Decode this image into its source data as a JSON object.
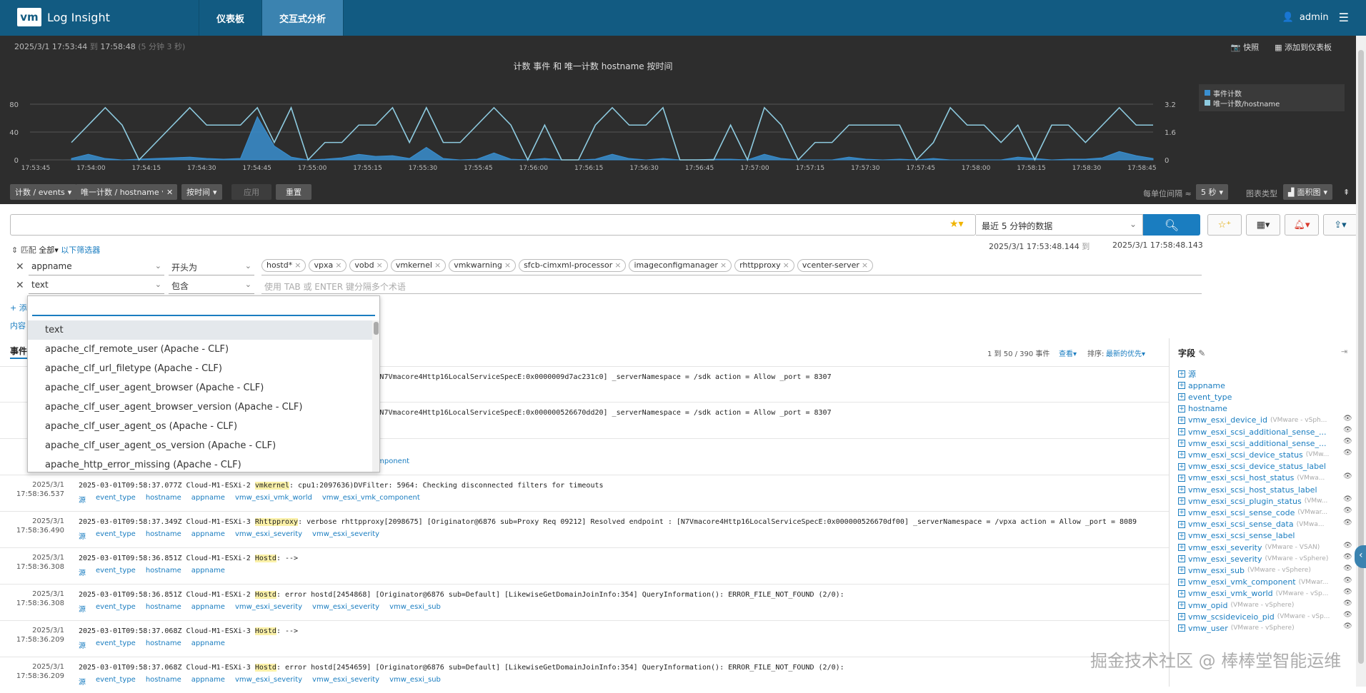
{
  "header": {
    "logo_mark": "vm",
    "app_title": "Log Insight",
    "tabs": [
      "仪表板",
      "交互式分析"
    ],
    "user": "admin"
  },
  "chart_pane": {
    "time_start": "2025/3/1 17:53:44",
    "time_to": "到",
    "time_end": "17:58:48",
    "duration": "(5 分钟 3 秒)",
    "snapshot": "快照",
    "add_to_dashboard": "添加到仪表板"
  },
  "chart_data": {
    "type": "area+line",
    "title": "计数 事件 和 唯一计数 hostname 按时间",
    "x_ticks": [
      "17:53:45",
      "17:54:00",
      "17:54:15",
      "17:54:30",
      "17:54:45",
      "17:55:00",
      "17:55:15",
      "17:55:30",
      "17:55:45",
      "17:56:00",
      "17:56:15",
      "17:56:30",
      "17:56:45",
      "17:57:00",
      "17:57:15",
      "17:57:30",
      "17:57:45",
      "17:58:00",
      "17:58:15",
      "17:58:30",
      "17:58:45"
    ],
    "y_left_ticks": [
      0,
      40,
      80
    ],
    "y_right_ticks": [
      0,
      1.6,
      3.2
    ],
    "ylim_left": [
      0,
      80
    ],
    "ylim_right": [
      0,
      3.2
    ],
    "legend_position": "right",
    "series": [
      {
        "name": "事件计数",
        "axis": "left",
        "color": "#3a8fd0",
        "values": [
          2,
          8,
          2,
          0,
          1,
          2,
          3,
          4,
          2,
          1,
          2,
          62,
          20,
          4,
          0,
          1,
          3,
          8,
          5,
          6,
          2,
          18,
          2,
          0,
          1,
          10,
          1,
          0,
          2,
          0,
          0,
          1,
          8,
          2,
          0,
          2,
          0,
          0,
          1,
          1,
          0,
          8,
          2,
          0,
          0,
          0,
          4,
          1,
          0,
          1,
          0,
          2,
          0,
          0,
          0,
          0,
          4,
          2,
          0,
          1,
          1,
          3,
          12,
          6,
          2
        ]
      },
      {
        "name": "唯一计数/hostname",
        "axis": "right",
        "color": "#8ecbe0",
        "values": [
          1,
          2,
          3,
          2,
          0,
          1,
          2,
          3,
          2,
          2,
          2,
          3,
          1,
          3,
          0,
          1,
          1,
          2,
          2,
          3,
          1,
          3,
          1,
          1,
          2,
          3,
          2,
          0,
          2,
          0,
          0,
          2,
          3,
          2,
          2,
          3,
          0,
          0,
          0,
          2,
          0,
          3,
          2,
          0,
          1,
          1,
          2,
          2,
          2,
          2,
          0,
          1,
          3,
          2,
          2,
          1,
          2,
          0,
          2,
          2,
          1,
          2,
          3,
          2,
          2
        ]
      }
    ]
  },
  "toolbar": {
    "count_events": "计数 / events",
    "unique_hostname": "唯一计数 / hostname",
    "by_time": "按时间",
    "apply": "应用",
    "reset": "重置",
    "interval_label": "每单位间隔 ≈",
    "interval_value": "5 秒",
    "chart_type_label": "图表类型",
    "chart_type_value": "面积图"
  },
  "search": {
    "query_value": "",
    "time_range": "最近 5 分钟的数据"
  },
  "filters": {
    "match_prefix": "匹配",
    "match_mode": "全部",
    "match_suffix": "以下筛选器",
    "ts_start": "2025/3/1 17:53:48.144",
    "ts_to": "到",
    "ts_end": "2025/3/1 17:58:48.143",
    "rows": [
      {
        "field": "appname",
        "op": "开头为",
        "tags": [
          "hostd*",
          "vpxa",
          "vobd",
          "vmkernel",
          "vmkwarning",
          "sfcb-cimxml-processor",
          "imageconfigmanager",
          "rhttpproxy",
          "vcenter-server"
        ]
      },
      {
        "field": "text",
        "op": "包含",
        "placeholder": "使用 TAB 或 ENTER 键分隔多个术语"
      }
    ],
    "add_link": "+ 添",
    "content_link": "内容"
  },
  "dropdown": {
    "items": [
      "text",
      "apache_clf_remote_user (Apache - CLF)",
      "apache_clf_url_filetype (Apache - CLF)",
      "apache_clf_user_agent_browser (Apache - CLF)",
      "apache_clf_user_agent_browser_version (Apache - CLF)",
      "apache_clf_user_agent_os (Apache - CLF)",
      "apache_clf_user_agent_os_version (Apache - CLF)",
      "apache_http_error_missing (Apache - CLF)"
    ]
  },
  "events": {
    "tab": "事件",
    "count": "1 到 50 / 390 事件",
    "view": "查看",
    "sort_label": "排序:",
    "sort_value": "最新的优先",
    "rows": [
      {
        "date": "",
        "time": "17",
        "pre": "",
        "src": "",
        "hl": "",
        "post": "y[2098684] [Originator@6876 sub=Proxy Req 00732] Resolved endpoint : [N7Vmacore4Http16LocalServiceSpecE:0x0000009d7ac231c0] _serverNamespace = /sdk action = Allow _port = 8307",
        "fields": []
      },
      {
        "date": "",
        "time": "17",
        "pre": "",
        "src": "",
        "hl": "",
        "post": "y[2098666] [Originator@6876 sub=Proxy Req 00726] Resolved endpoint : [N7Vmacore4Http16LocalServiceSpecE:0x000000526670dd20] _serverNamespace = /sdk action = Allow _port = 8307",
        "fields": []
      },
      {
        "date": "",
        "time": "",
        "pre": "",
        "src": "",
        "hl": "",
        "post": "ter: 5964: Checking disconnected filters for timeouts",
        "fields": [
          "omponent"
        ]
      },
      {
        "date": "2025/3/1",
        "time": "17:58:36.537",
        "pre": "2025-03-01T09:58:37.077Z Cloud-M1-ESXi-2 ",
        "hl": "vmkernel",
        "post": ": cpu1:2097636)DVFilter: 5964: Checking disconnected filters for timeouts",
        "fields": [
          "源",
          "event_type",
          "hostname",
          "appname",
          "vmw_esxi_vmk_world",
          "vmw_esxi_vmk_component"
        ]
      },
      {
        "date": "2025/3/1",
        "time": "17:58:36.490",
        "pre": "2025-03-01T09:58:37.349Z Cloud-M1-ESXi-3 ",
        "hl": "Rhttpproxy",
        "post": ": verbose rhttpproxy[2098675] [Originator@6876 sub=Proxy Req 09212] Resolved endpoint : [N7Vmacore4Http16LocalServiceSpecE:0x000000526670df00] _serverNamespace = /vpxa action = Allow _port = 8089",
        "fields": [
          "源",
          "event_type",
          "hostname",
          "appname",
          "vmw_esxi_severity",
          "vmw_esxi_severity"
        ]
      },
      {
        "date": "2025/3/1",
        "time": "17:58:36.308",
        "pre": "2025-03-01T09:58:36.851Z Cloud-M1-ESXi-2 ",
        "hl": "Hostd",
        "post": ": -->",
        "fields": [
          "源",
          "event_type",
          "hostname",
          "appname"
        ]
      },
      {
        "date": "2025/3/1",
        "time": "17:58:36.308",
        "pre": "2025-03-01T09:58:36.851Z Cloud-M1-ESXi-2 ",
        "hl": "Hostd",
        "post": ": error hostd[2454868] [Originator@6876 sub=Default] [LikewiseGetDomainJoinInfo:354] QueryInformation(): ERROR_FILE_NOT_FOUND (2/0):",
        "fields": [
          "源",
          "event_type",
          "hostname",
          "appname",
          "vmw_esxi_severity",
          "vmw_esxi_severity",
          "vmw_esxi_sub"
        ]
      },
      {
        "date": "2025/3/1",
        "time": "17:58:36.209",
        "pre": "2025-03-01T09:58:37.068Z Cloud-M1-ESXi-3 ",
        "hl": "Hostd",
        "post": ": -->",
        "fields": [
          "源",
          "event_type",
          "hostname",
          "appname"
        ]
      },
      {
        "date": "2025/3/1",
        "time": "17:58:36.209",
        "pre": "2025-03-01T09:58:37.068Z Cloud-M1-ESXi-3 ",
        "hl": "Hostd",
        "post": ": error hostd[2454659] [Originator@6876 sub=Default] [LikewiseGetDomainJoinInfo:354] QueryInformation(): ERROR_FILE_NOT_FOUND (2/0):",
        "fields": [
          "源",
          "event_type",
          "hostname",
          "appname",
          "vmw_esxi_severity",
          "vmw_esxi_severity",
          "vmw_esxi_sub"
        ]
      }
    ]
  },
  "fields_panel": {
    "title": "字段",
    "items": [
      {
        "name": "源",
        "src": "",
        "eye": false
      },
      {
        "name": "appname",
        "src": "",
        "eye": false
      },
      {
        "name": "event_type",
        "src": "",
        "eye": false
      },
      {
        "name": "hostname",
        "src": "",
        "eye": false
      },
      {
        "name": "vmw_esxi_device_id",
        "src": "(VMware - vSph...",
        "eye": true
      },
      {
        "name": "vmw_esxi_scsi_additional_sense_...",
        "src": "",
        "eye": true
      },
      {
        "name": "vmw_esxi_scsi_additional_sense_...",
        "src": "",
        "eye": true
      },
      {
        "name": "vmw_esxi_scsi_device_status",
        "src": "(VMw...",
        "eye": true
      },
      {
        "name": "vmw_esxi_scsi_device_status_label",
        "src": "",
        "eye": false
      },
      {
        "name": "vmw_esxi_scsi_host_status",
        "src": "(VMwa...",
        "eye": true
      },
      {
        "name": "vmw_esxi_scsi_host_status_label",
        "src": "",
        "eye": false
      },
      {
        "name": "vmw_esxi_scsi_plugin_status",
        "src": "(VMw...",
        "eye": true
      },
      {
        "name": "vmw_esxi_scsi_sense_code",
        "src": "(VMwar...",
        "eye": true
      },
      {
        "name": "vmw_esxi_scsi_sense_data",
        "src": "(VMwa...",
        "eye": true
      },
      {
        "name": "vmw_esxi_scsi_sense_label",
        "src": "",
        "eye": false
      },
      {
        "name": "vmw_esxi_severity",
        "src": "(VMware - VSAN)",
        "eye": true
      },
      {
        "name": "vmw_esxi_severity",
        "src": "(VMware - vSphere)",
        "eye": true
      },
      {
        "name": "vmw_esxi_sub",
        "src": "(VMware - vSphere)",
        "eye": true
      },
      {
        "name": "vmw_esxi_vmk_component",
        "src": "(VMwar...",
        "eye": true
      },
      {
        "name": "vmw_esxi_vmk_world",
        "src": "(VMware - vSp...",
        "eye": true
      },
      {
        "name": "vmw_opid",
        "src": "(VMware - vSphere)",
        "eye": true
      },
      {
        "name": "vmw_scsideviceio_pid",
        "src": "(VMware - vSp...",
        "eye": true
      },
      {
        "name": "vmw_user",
        "src": "(VMware - vSphere)",
        "eye": true
      }
    ]
  },
  "watermark": "掘金技术社区 @ 棒棒堂智能运维"
}
